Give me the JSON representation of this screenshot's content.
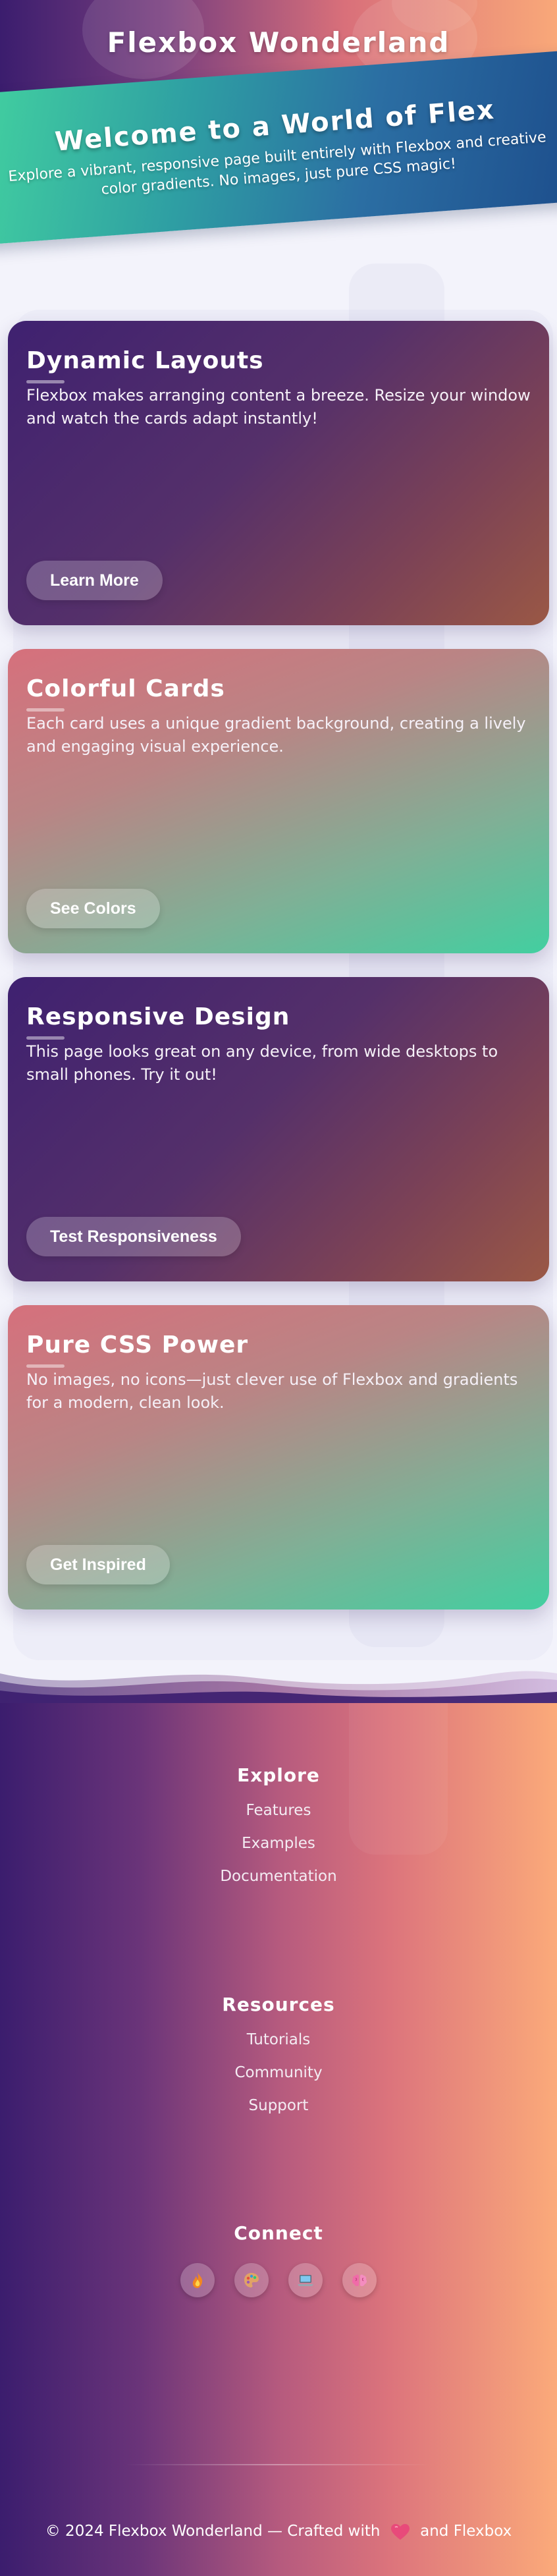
{
  "header": {
    "title": "Flexbox Wonderland"
  },
  "hero": {
    "title": "Welcome to a World of Flex",
    "subtitle": "Explore a vibrant, responsive page built entirely with Flexbox and creative color gradients. No images, just pure CSS magic!"
  },
  "cards": [
    {
      "title": "Dynamic Layouts",
      "text": "Flexbox makes arranging content a breeze. Resize your window and watch the cards adapt instantly!",
      "button": "Learn More"
    },
    {
      "title": "Colorful Cards",
      "text": "Each card uses a unique gradient background, creating a lively and engaging visual experience.",
      "button": "See Colors"
    },
    {
      "title": "Responsive Design",
      "text": "This page looks great on any device, from wide desktops to small phones. Try it out!",
      "button": "Test Responsiveness"
    },
    {
      "title": "Pure CSS Power",
      "text": "No images, no icons—just clever use of Flexbox and gradients for a modern, clean look.",
      "button": "Get Inspired"
    }
  ],
  "footer": {
    "explore": {
      "heading": "Explore",
      "links": [
        "Features",
        "Examples",
        "Documentation"
      ]
    },
    "resources": {
      "heading": "Resources",
      "links": [
        "Tutorials",
        "Community",
        "Support"
      ]
    },
    "connect": {
      "heading": "Connect",
      "socials": [
        "fire-icon",
        "palette-icon",
        "laptop-icon",
        "brain-icon"
      ]
    },
    "copyright_before": "© 2024 Flexbox Wonderland — Crafted with",
    "copyright_after": "and Flexbox"
  },
  "colors": {
    "header_start": "#3b1d6e",
    "header_end": "#f9a879",
    "hero_start": "#42d0a0",
    "hero_end": "#1d4e8c",
    "card_purple": "#3f2170",
    "card_pink": "#d6707c",
    "card_green": "#42cfa0"
  }
}
